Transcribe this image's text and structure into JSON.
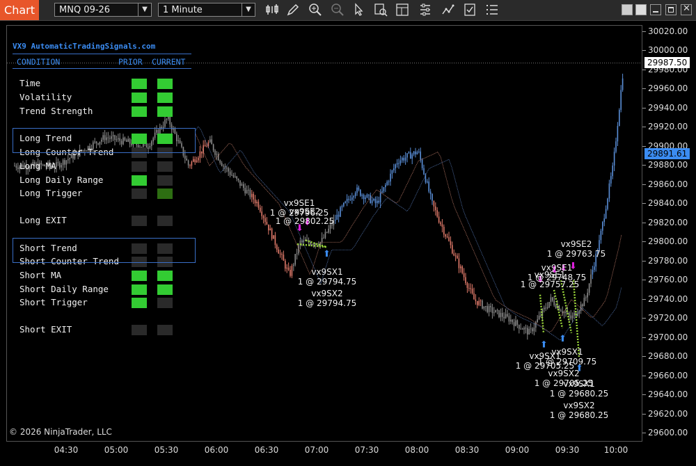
{
  "toolbar": {
    "tab_label": "Chart",
    "instrument": "MNQ 09-26",
    "interval": "1 Minute",
    "icons": [
      "bar-type-icon",
      "draw-pencil-icon",
      "zoom-in-icon",
      "zoom-out-icon",
      "pointer-icon",
      "data-box-icon",
      "templates-icon",
      "properties-icon",
      "indicators-icon",
      "strategies-icon",
      "list-icon"
    ]
  },
  "colors": {
    "accent": "#e8562a",
    "panel_blue": "#3b8cf2",
    "green": "#33cc33",
    "dark_green": "#2d6e12",
    "empty": "#2a2a2a",
    "up_candle": "#5a8fd8",
    "down_candle": "#e07a6a",
    "neutral_candle": "#8c8c8c",
    "last_price_bg": "#ffffff",
    "sma_price_bg": "#3b8cf2"
  },
  "panel": {
    "title": "VX9 AutomaticTradingSignals.com",
    "headers": {
      "condition": "CONDITION",
      "prior": "PRIOR",
      "current": "CURRENT"
    },
    "rows": [
      {
        "label": "Time",
        "prior": "green",
        "current": "green"
      },
      {
        "label": "Volatility",
        "prior": "green",
        "current": "green"
      },
      {
        "label": "Trend Strength",
        "prior": "green",
        "current": "green"
      },
      {
        "label": "Long Trend",
        "prior": "green",
        "current": "green"
      },
      {
        "label": "Long Counter Trend",
        "prior": "empty",
        "current": "empty"
      },
      {
        "label": "Long MA",
        "prior": "empty",
        "current": "empty"
      },
      {
        "label": "Long Daily Range",
        "prior": "green",
        "current": "empty"
      },
      {
        "label": "Long Trigger",
        "prior": "empty",
        "current": "dark_green"
      },
      {
        "label": "Long EXIT",
        "prior": "empty",
        "current": "empty"
      },
      {
        "label": "Short Trend",
        "prior": "empty",
        "current": "empty"
      },
      {
        "label": "Short Counter Trend",
        "prior": "empty",
        "current": "empty"
      },
      {
        "label": "Short MA",
        "prior": "green",
        "current": "green"
      },
      {
        "label": "Short Daily Range",
        "prior": "green",
        "current": "green"
      },
      {
        "label": "Short Trigger",
        "prior": "green",
        "current": "empty"
      },
      {
        "label": "Short EXIT",
        "prior": "empty",
        "current": "empty"
      }
    ]
  },
  "axis": {
    "y_ticks": [
      "30020.00",
      "30000.00",
      "29980.00",
      "29960.00",
      "29940.00",
      "29920.00",
      "29900.00",
      "29880.00",
      "29860.00",
      "29840.00",
      "29820.00",
      "29800.00",
      "29780.00",
      "29760.00",
      "29740.00",
      "29720.00",
      "29700.00",
      "29680.00",
      "29660.00",
      "29640.00",
      "29620.00",
      "29600.00"
    ],
    "x_ticks": [
      "04:30",
      "05:00",
      "05:30",
      "06:00",
      "06:30",
      "07:00",
      "07:30",
      "08:00",
      "08:30",
      "09:00",
      "09:30",
      "10:00"
    ],
    "last_price": "29987.50",
    "sma_price": "29891.61"
  },
  "annotations": [
    {
      "id": "se1-a",
      "lines": [
        "vx9SE1",
        "1 @ 29796.25"
      ]
    },
    {
      "id": "se2-a",
      "lines": [
        "vx9SE2",
        "1 @ 29802.25"
      ]
    },
    {
      "id": "sx1-a",
      "lines": [
        "vx9SX1",
        "1 @ 29794.75"
      ]
    },
    {
      "id": "sx2-a",
      "lines": [
        "vx9SX2",
        "1 @ 29794.75"
      ]
    },
    {
      "id": "se2-b",
      "lines": [
        "vx9SE2",
        "1 @ 29763.75"
      ]
    },
    {
      "id": "se-cluster",
      "lines": [
        "vx9SE1",
        "1 @ 29748.75"
      ]
    },
    {
      "id": "se-cluster2",
      "lines": [
        "vx9SE1",
        "1 @ 29757.25"
      ]
    },
    {
      "id": "sx1-b",
      "lines": [
        "vx9SX1",
        "1 @ 29709.75"
      ]
    },
    {
      "id": "sx1-c",
      "lines": [
        "vx9SX1",
        "1 @ 29705.25"
      ]
    },
    {
      "id": "sx2-b",
      "lines": [
        "vx9SX2",
        "1 @ 29705.25"
      ]
    },
    {
      "id": "sx1-d",
      "lines": [
        "vx9SX1",
        "1 @ 29680.25"
      ]
    },
    {
      "id": "sx2-c",
      "lines": [
        "vx9SX2",
        "1 @ 29680.25"
      ]
    }
  ],
  "copyright": "© 2026 NinjaTrader, LLC"
}
